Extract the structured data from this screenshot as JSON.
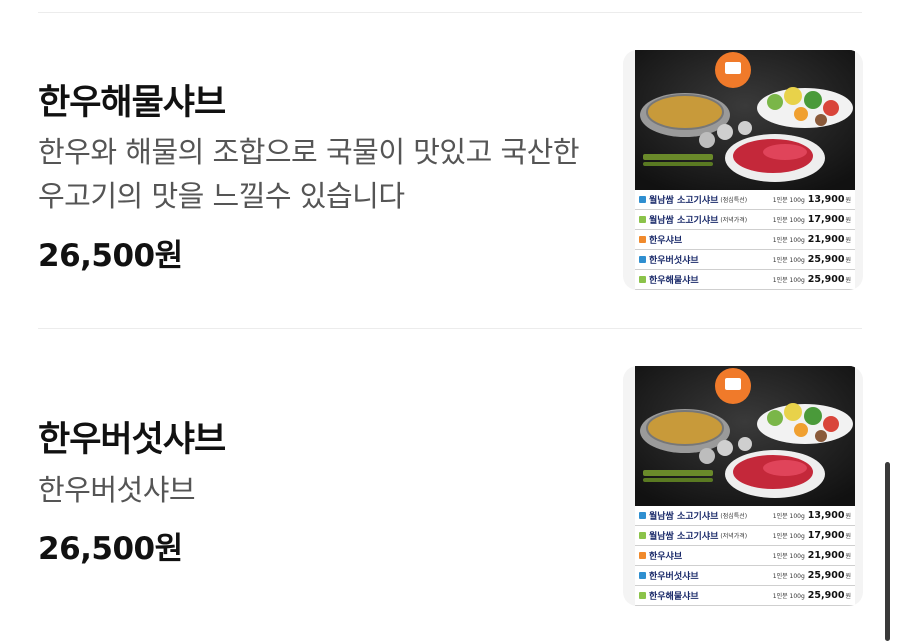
{
  "items": [
    {
      "title": "한우해물샤브",
      "description": "한우와 해물의 조합으로 국물이 맛있고 국산한우고기의 맛을 느낄수 있습니다",
      "price": "26,500원"
    },
    {
      "title": "한우버섯샤브",
      "description": "한우버섯샤브",
      "price": "26,500원"
    }
  ],
  "image_menu": [
    {
      "name": "월남쌈 소고기샤브",
      "note": "(점심특선)",
      "unit": "1인분 100g",
      "price": "13,900",
      "won": "원",
      "marker_color": "#2f8fd0"
    },
    {
      "name": "월남쌈 소고기샤브",
      "note": "(저녁가격)",
      "unit": "1인분 100g",
      "price": "17,900",
      "won": "원",
      "marker_color": "#8bc34a"
    },
    {
      "name": "한우샤브",
      "note": "",
      "unit": "1인분 100g",
      "price": "21,900",
      "won": "원",
      "marker_color": "#f08a2c"
    },
    {
      "name": "한우버섯샤브",
      "note": "",
      "unit": "1인분 100g",
      "price": "25,900",
      "won": "원",
      "marker_color": "#2f8fd0"
    },
    {
      "name": "한우해물샤브",
      "note": "",
      "unit": "1인분 100g",
      "price": "25,900",
      "won": "원",
      "marker_color": "#8bc34a"
    }
  ]
}
